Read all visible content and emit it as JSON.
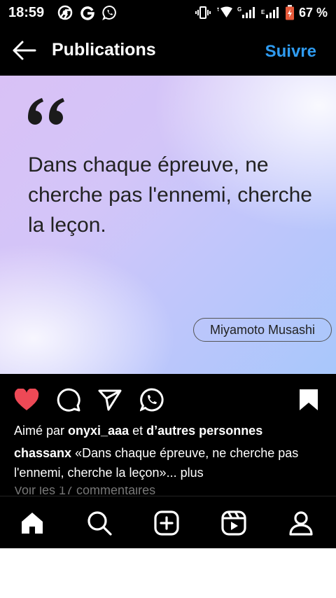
{
  "status_bar": {
    "time": "18:59",
    "battery": "67 %",
    "icons_left": [
      "chrome-icon",
      "google-icon",
      "whatsapp-icon"
    ],
    "icons_right": [
      "vibrate-icon",
      "wifi-icon",
      "signal-icon",
      "signal-icon",
      "battery-icon"
    ]
  },
  "header": {
    "title": "Publications",
    "follow_label": "Suivre",
    "accent_color": "#2f9bf0"
  },
  "post": {
    "quote": "Dans chaque épreuve, ne cherche pas l'ennemi, cherche la leçon.",
    "author": "Miyamoto Musashi"
  },
  "actions": {
    "like_icon": "heart-filled-icon",
    "comment_icon": "comment-icon",
    "share_icon": "send-icon",
    "whatsapp_icon": "whatsapp-icon",
    "save_icon": "bookmark-filled-icon",
    "like_color": "#ed4956"
  },
  "likes": {
    "prefix": "Aimé par",
    "user": "onyxi_aaa",
    "middle": "et",
    "others": "d’autres personnes"
  },
  "caption": {
    "user": "chassanx",
    "text": "«Dans chaque épreuve, ne cherche pas l'ennemi, cherche la leçon»...",
    "more": "plus"
  },
  "comments": {
    "label": "Voir les 17 commentaires"
  },
  "bottom_nav": [
    "home-icon",
    "search-icon",
    "create-icon",
    "reels-icon",
    "profile-icon"
  ]
}
